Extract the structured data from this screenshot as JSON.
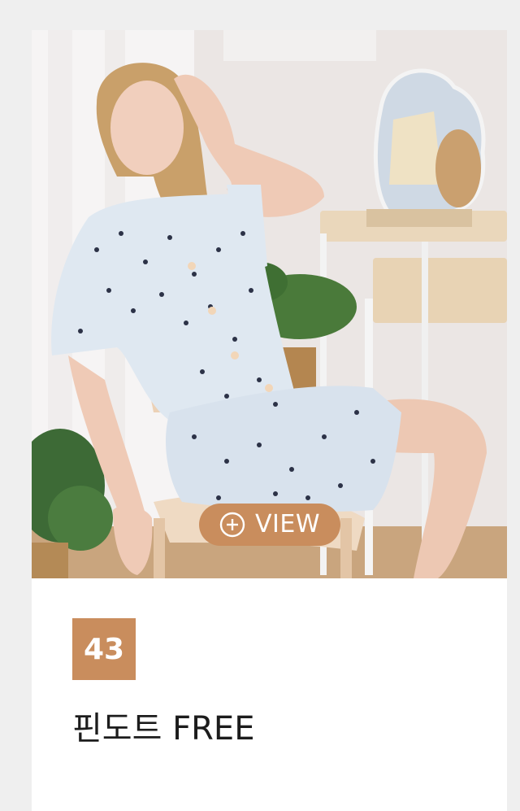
{
  "product": {
    "number": "43",
    "title": "핀도트 FREE",
    "view_label": "VIEW",
    "photo_alt": ""
  },
  "icons": {
    "view": "plus-circle-icon"
  },
  "colors": {
    "accent": "#c98d5d",
    "page_background": "#efefef",
    "card_background": "#ffffff",
    "title_text": "#1c1c1c"
  }
}
